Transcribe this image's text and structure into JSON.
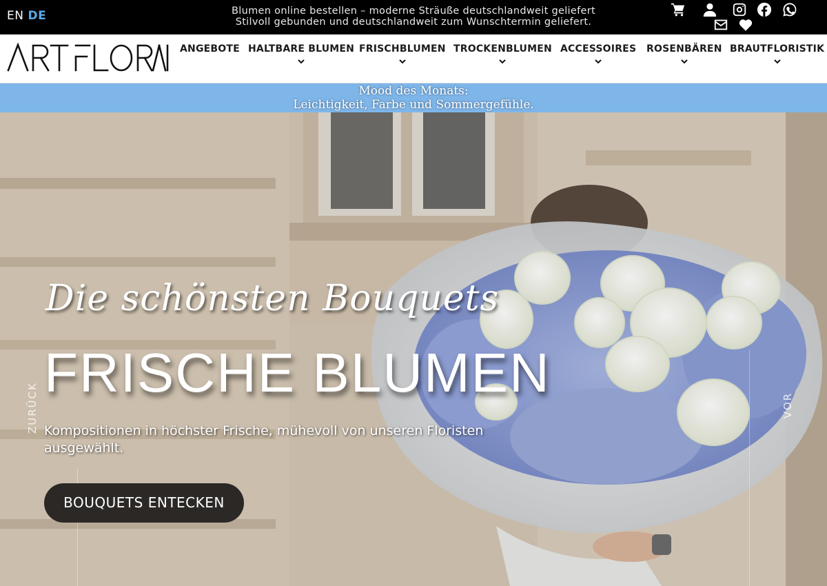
{
  "topbar": {
    "lang_en": "EN",
    "lang_de": "DE",
    "tagline_line1": "Blumen online bestellen – moderne Sträuße deutschlandweit geliefert",
    "tagline_line2": "Stilvoll gebunden und deutschlandweit zum Wunschtermin geliefert.",
    "icons": [
      "cart-icon",
      "user-icon",
      "instagram-icon",
      "facebook-icon",
      "whatsapp-icon",
      "mail-icon",
      "heart-icon"
    ]
  },
  "header": {
    "logo_text": "ART FLORAL",
    "nav": [
      {
        "label": "ANGEBOTE"
      },
      {
        "label": "HALTBARE BLUMEN"
      },
      {
        "label": "FRISCHBLUMEN"
      },
      {
        "label": "TROCKENBLUMEN"
      },
      {
        "label": "ACCESSOIRES"
      },
      {
        "label": "ROSENBÄREN"
      },
      {
        "label": "BRAUTFLORISTIK"
      }
    ]
  },
  "announcement": {
    "line1": "Mood des Monats:",
    "line2": "Leichtigkeit, Farbe und Sommergefühle."
  },
  "hero": {
    "script": "Die schönsten Bouquets",
    "title": "FRISCHE BLUMEN",
    "subtitle": "Kompositionen in höchster Frische, mühevoll von unseren Floristen ausgewählt.",
    "cta": "BOUQUETS ENTECKEN",
    "prev": "ZURÜCK",
    "next": "VOR"
  },
  "colors": {
    "accent": "#5aa9e6",
    "announce_bg": "#7eb6ea",
    "cta_bg": "#2b2826"
  }
}
